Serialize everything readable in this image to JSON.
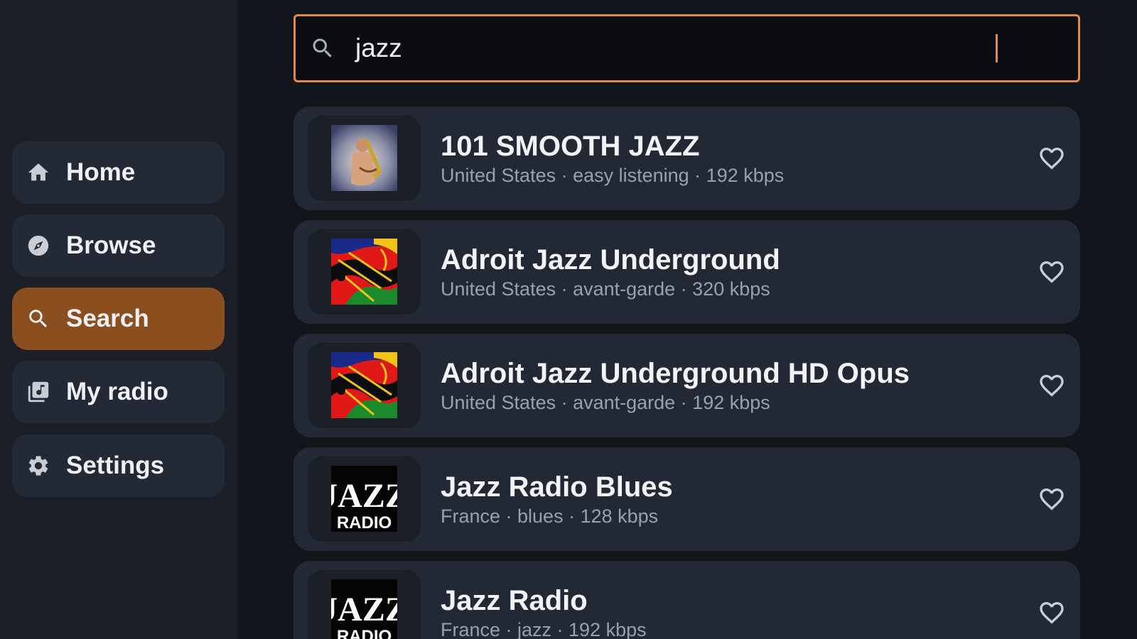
{
  "sidebar": {
    "items": [
      {
        "label": "Home",
        "icon": "home-icon",
        "active": false
      },
      {
        "label": "Browse",
        "icon": "compass-icon",
        "active": false
      },
      {
        "label": "Search",
        "icon": "search-icon",
        "active": true
      },
      {
        "label": "My radio",
        "icon": "library-music-icon",
        "active": false
      },
      {
        "label": "Settings",
        "icon": "gear-icon",
        "active": false
      }
    ]
  },
  "search": {
    "value": "jazz",
    "icon": "search-icon"
  },
  "results": [
    {
      "title": "101 SMOOTH JAZZ",
      "subtitle": "United States · easy listening · 192 kbps",
      "logo": "saxophone-photo"
    },
    {
      "title": "Adroit Jazz Underground",
      "subtitle": "United States · avant-garde · 320 kbps",
      "logo": "abstract-jazz-art"
    },
    {
      "title": "Adroit Jazz Underground HD Opus",
      "subtitle": "United States · avant-garde · 192 kbps",
      "logo": "abstract-jazz-art"
    },
    {
      "title": "Jazz Radio Blues",
      "subtitle": "France · blues · 128 kbps",
      "logo": "jazz-radio-logo",
      "logo_text": [
        "JAZZ",
        "RADIO"
      ]
    },
    {
      "title": "Jazz Radio",
      "subtitle": "France · jazz · 192 kbps",
      "logo": "jazz-radio-logo",
      "logo_text": [
        "JAZZ",
        "RADIO"
      ]
    }
  ],
  "colors": {
    "accent": "#e38a45",
    "active_nav": "#8a4e1f",
    "background": "#12151b",
    "sidebar": "#1a1f28",
    "card": "#222834"
  }
}
